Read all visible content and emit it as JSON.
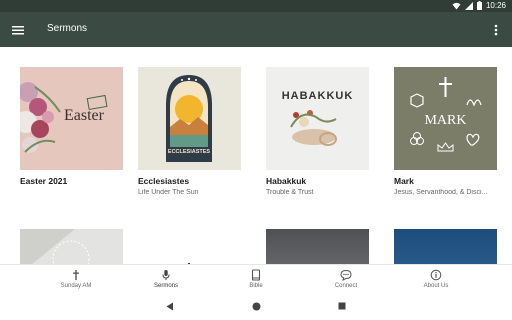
{
  "status": {
    "time": "10:26"
  },
  "appbar": {
    "title": "Sermons"
  },
  "series": [
    {
      "title": "Easter 2021",
      "subtitle": "",
      "art_text": "Easter"
    },
    {
      "title": "Ecclesiastes",
      "subtitle": "Life Under The Sun",
      "art_text": "ECCLESIASTES"
    },
    {
      "title": "Habakkuk",
      "subtitle": "Trouble & Trust",
      "art_text": "HABAKKUK"
    },
    {
      "title": "Mark",
      "subtitle": "Jesus, Servanthood, & Disci...",
      "art_text": "MARK"
    }
  ],
  "nav": [
    {
      "label": "Sunday AM",
      "icon": "cross-icon"
    },
    {
      "label": "Sermons",
      "icon": "microphone-icon"
    },
    {
      "label": "Bible",
      "icon": "book-icon"
    },
    {
      "label": "Connect",
      "icon": "chat-icon"
    },
    {
      "label": "About Us",
      "icon": "info-icon"
    }
  ],
  "colors": {
    "statusbar": "#2f3d36",
    "appbar": "#3b4a43",
    "mark_bg": "#7b7d68",
    "easter_bg": "#e6c7bd"
  }
}
